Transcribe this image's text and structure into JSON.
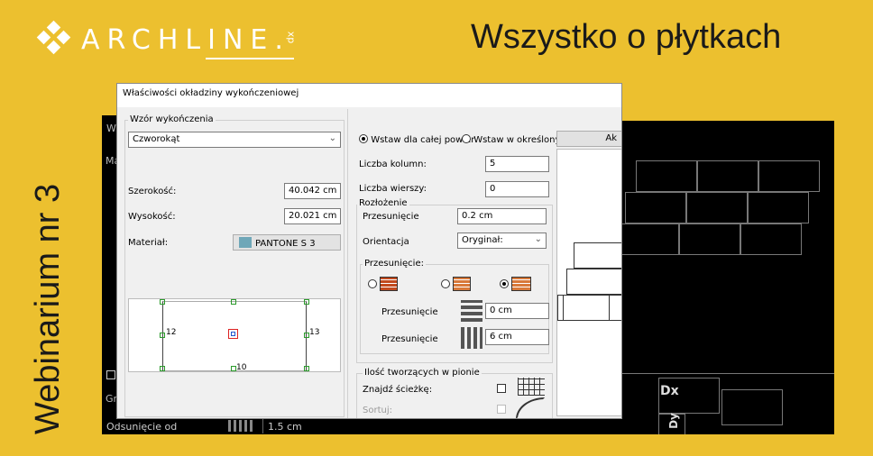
{
  "brand": {
    "logo_text": "ARCH",
    "logo_text2": "LINE.",
    "logo_suffix": "xp"
  },
  "headline": "Wszystko o płytkach",
  "vertical_title": "Webinarium nr 3",
  "cad": {
    "left_label_w": "W",
    "left_label_ma": "Ma",
    "left_label_gr": "Gr",
    "bottom_label": "Odsunięcie od",
    "bottom_value": "1.5 cm",
    "dx_label": "Dx",
    "dy_label": "Dy"
  },
  "dialog": {
    "title": "Właściwości okładziny wykończeniowej",
    "left": {
      "group_label": "Wzór wykończenia",
      "pattern_value": "Czworokąt",
      "width_label": "Szerokość:",
      "width_value": "40.042 cm",
      "height_label": "Wysokość:",
      "height_value": "20.021 cm",
      "material_label": "Materiał:",
      "material_value": "PANTONE S 3",
      "material_color": "#6fa7b8",
      "preview_labels": [
        "12",
        "13",
        "10"
      ]
    },
    "right": {
      "radio_whole": "Wstaw dla całej powier",
      "radio_defined": "Wstaw w określonym",
      "top_button": "Ak",
      "columns_label": "Liczba kolumn:",
      "columns_value": "5",
      "rows_label": "Liczba wierszy:",
      "rows_value": "0",
      "layout_group": "Rozłożenie",
      "offset_label": "Przesunięcie",
      "offset_value": "0.2 cm",
      "orientation_label": "Orientacja",
      "orientation_value": "Oryginał:",
      "shift_group": "Przesunięcie:",
      "shift_row1_label": "Przesunięcie",
      "shift_row1_value": "0 cm",
      "shift_row2_label": "Przesunięcie",
      "shift_row2_value": "6 cm",
      "vertical_group": "Ilość tworzących w pionie",
      "find_path_label": "Znajdź ścieżkę:",
      "sort_label": "Sortuj:"
    }
  }
}
